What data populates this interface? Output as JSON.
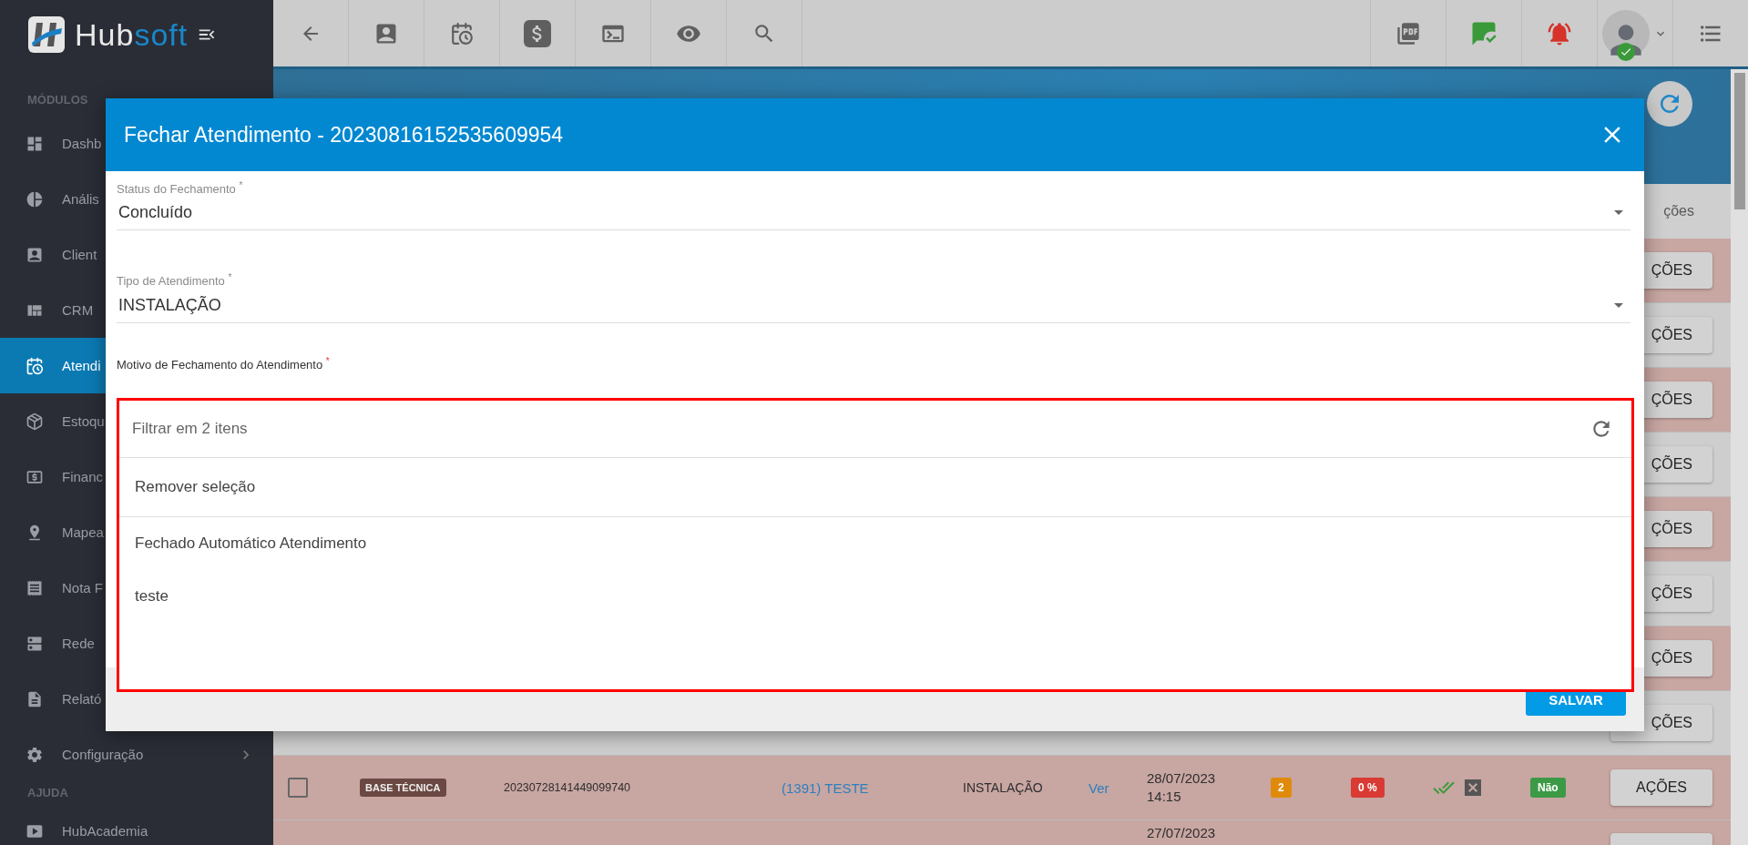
{
  "logo": {
    "part_1": "Hub",
    "part_2": "soft"
  },
  "sidebar": {
    "sections": [
      {
        "title": "MÓDULOS",
        "items": [
          {
            "label": "Dashb",
            "selected": false,
            "chevron": false
          },
          {
            "label": "Anális",
            "selected": false,
            "chevron": false
          },
          {
            "label": "Client",
            "selected": false,
            "chevron": false
          },
          {
            "label": "CRM",
            "selected": false,
            "chevron": false
          },
          {
            "label": "Atendi",
            "selected": true,
            "chevron": false
          },
          {
            "label": "Estoqu",
            "selected": false,
            "chevron": false
          },
          {
            "label": "Financ",
            "selected": false,
            "chevron": false
          },
          {
            "label": "Mapea",
            "selected": false,
            "chevron": false
          },
          {
            "label": "Nota F",
            "selected": false,
            "chevron": false
          },
          {
            "label": "Rede",
            "selected": false,
            "chevron": false
          },
          {
            "label": "Relató",
            "selected": false,
            "chevron": false
          },
          {
            "label": "Configuração",
            "selected": false,
            "chevron": true
          }
        ]
      },
      {
        "title": "AJUDA",
        "items": [
          {
            "label": "HubAcademia",
            "selected": false,
            "chevron": false
          }
        ]
      }
    ]
  },
  "table": {
    "header_last": "ções",
    "rows": [
      {
        "highlighted": true,
        "action": "ÇÕES",
        "partial": true
      },
      {
        "highlighted": false,
        "action": "ÇÕES",
        "partial": true
      },
      {
        "highlighted": true,
        "action": "ÇÕES",
        "partial": true
      },
      {
        "highlighted": false,
        "action": "ÇÕES",
        "partial": true
      },
      {
        "highlighted": true,
        "action": "ÇÕES",
        "partial": true
      },
      {
        "highlighted": false,
        "action": "ÇÕES",
        "partial": true
      },
      {
        "highlighted": true,
        "action": "ÇÕES",
        "partial": true
      },
      {
        "highlighted": false,
        "action": "ÇÕES",
        "partial": true
      },
      {
        "highlighted": true,
        "action": "AÇÕES",
        "partial": false,
        "checked": false,
        "tag": "BASE TÉCNICA",
        "protocol": "20230728141449099740",
        "client": "(1391) TESTE",
        "type": "INSTALAÇÃO",
        "link": "Ver",
        "date": "28/07/2023",
        "time": "14:15",
        "count": "2",
        "percent": "0 %",
        "flag": "Não"
      },
      {
        "highlighted": true,
        "date": "27/07/2023"
      }
    ]
  },
  "modal": {
    "title": "Fechar Atendimento - 20230816152535609954",
    "fields": [
      {
        "label": "Status do Fechamento $^{*}$",
        "value": "Concluído"
      },
      {
        "label": "Tipo de Atendimento $^{*}$",
        "value": "INSTALAÇÃO"
      }
    ],
    "motive_label": "Motivo de Fechamento do Atendimento $^{*}$",
    "dropdown": {
      "placeholder": "Filtrar em 2 itens",
      "clear": "Remover seleção",
      "options": [
        "Fechado Automático Atendimento",
        "teste"
      ]
    },
    "save": "SALVAR"
  }
}
